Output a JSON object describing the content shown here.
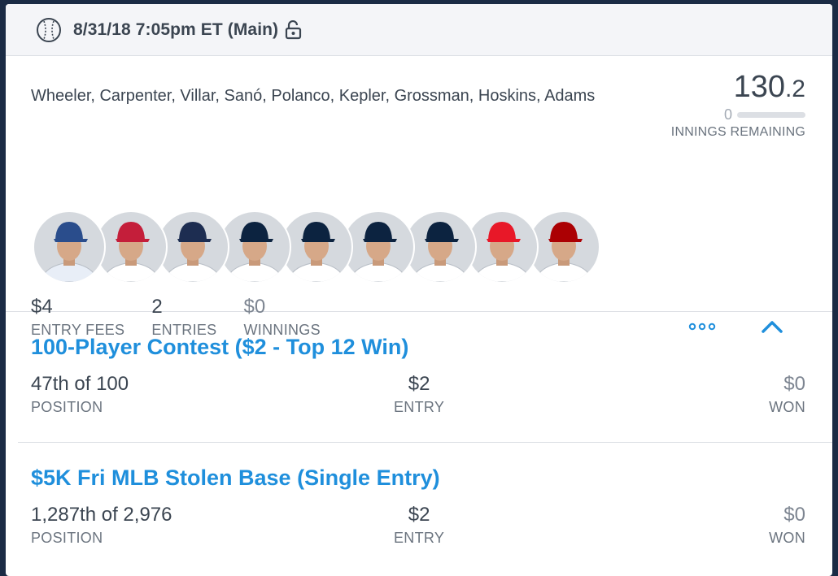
{
  "slate": {
    "title": "8/31/18 7:05pm ET (Main)"
  },
  "lineup": {
    "players": "Wheeler, Carpenter, Villar, Sanó, Polanco, Kepler, Grossman, Hoskins, Adams",
    "score_whole": "130",
    "score_decimal": ".2",
    "innings_remaining_count": "0",
    "innings_remaining_label": "INNINGS REMAINING",
    "avatars": [
      {
        "cap": "#2a4d8c",
        "jersey": "#e8eef7"
      },
      {
        "cap": "#c41e3a",
        "jersey": "#ffffff"
      },
      {
        "cap": "#1d2d51",
        "jersey": "#ffffff"
      },
      {
        "cap": "#0c2340",
        "jersey": "#ffffff"
      },
      {
        "cap": "#0c2340",
        "jersey": "#ffffff"
      },
      {
        "cap": "#0c2340",
        "jersey": "#ffffff"
      },
      {
        "cap": "#0c2340",
        "jersey": "#ffffff"
      },
      {
        "cap": "#e81828",
        "jersey": "#ffffff"
      },
      {
        "cap": "#ab0003",
        "jersey": "#ffffff"
      }
    ]
  },
  "stats": {
    "entry_fees_value": "$4",
    "entry_fees_label": "ENTRY FEES",
    "entries_value": "2",
    "entries_label": "ENTRIES",
    "winnings_value": "$0",
    "winnings_label": "WINNINGS"
  },
  "contests": [
    {
      "title": "100-Player Contest ($2 - Top 12 Win)",
      "position_value": "47th of 100",
      "position_label": "POSITION",
      "entry_value": "$2",
      "entry_label": "ENTRY",
      "won_value": "$0",
      "won_label": "WON"
    },
    {
      "title": "$5K Fri MLB Stolen Base (Single Entry)",
      "position_value": "1,287th of 2,976",
      "position_label": "POSITION",
      "entry_value": "$2",
      "entry_label": "ENTRY",
      "won_value": "$0",
      "won_label": "WON"
    }
  ],
  "colors": {
    "accent": "#1f8fdc",
    "text": "#3b4551",
    "muted": "#6b747f",
    "background": "#1b2b45"
  }
}
